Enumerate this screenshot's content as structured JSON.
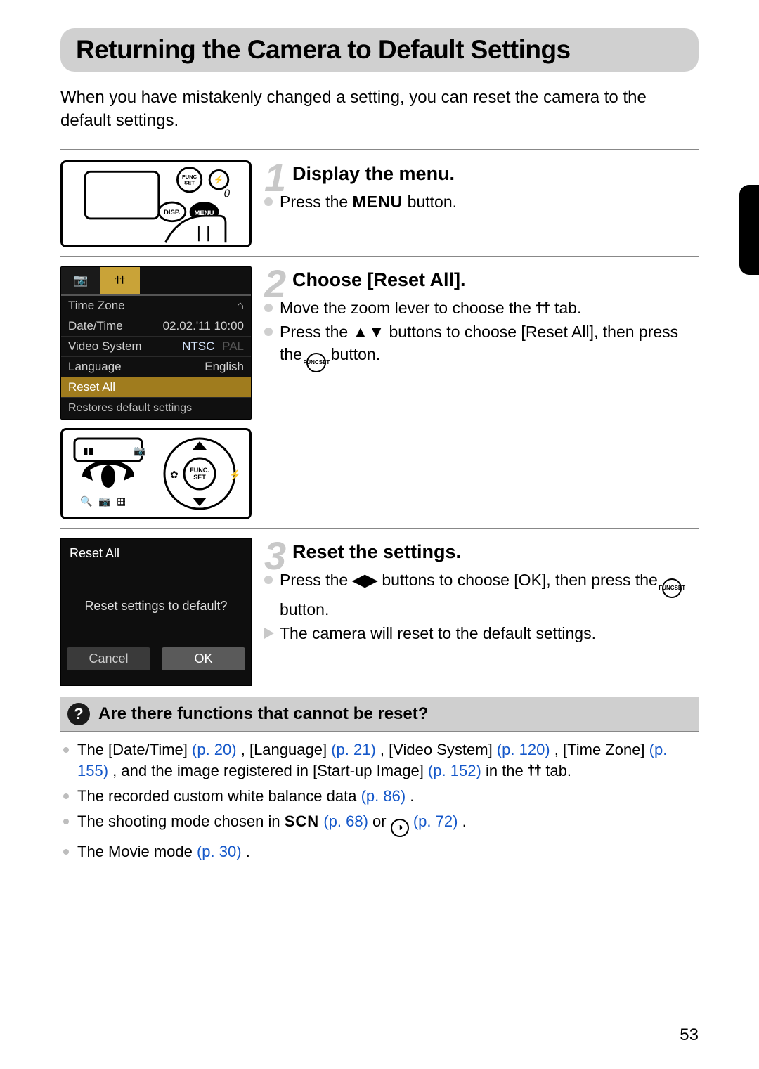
{
  "title": "Returning the Camera to Default Settings",
  "intro": "When you have mistakenly changed a setting, you can reset the camera to the default settings.",
  "steps": [
    {
      "num": "1",
      "heading": "Display the menu.",
      "line1a": "Press the ",
      "menu_word": "MENU",
      "line1b": " button."
    },
    {
      "num": "2",
      "heading": "Choose [Reset All].",
      "line1a": "Move the zoom lever to choose the ",
      "tool_glyph": "✦",
      "line1b": " tab.",
      "line2a": "Press the ",
      "ud_glyph": "▲▼",
      "line2b": " buttons to choose [Reset All], then press the ",
      "line2c": " button."
    },
    {
      "num": "3",
      "heading": "Reset the settings.",
      "line1a": "Press the ",
      "lr_glyph": "◀▶",
      "line1b": " buttons to choose [OK], then press the ",
      "line1c": " button.",
      "result": "The camera will reset to the default settings."
    }
  ],
  "menu_shot": {
    "items": [
      {
        "label": "Time Zone",
        "value": "⌂"
      },
      {
        "label": "Date/Time",
        "value": "02.02.'11 10:00"
      },
      {
        "label": "Video System",
        "value": "NTSC",
        "extra": "PAL"
      },
      {
        "label": "Language",
        "value": "English"
      },
      {
        "label": "Reset All",
        "value": ""
      }
    ],
    "footer": "Restores default settings"
  },
  "reset_shot": {
    "title": "Reset All",
    "msg": "Reset settings to default?",
    "cancel": "Cancel",
    "ok": "OK"
  },
  "funcset_top": "FUNC",
  "funcset_bot": "SET",
  "info": {
    "heading": "Are there functions that cannot be reset?",
    "i1a": "The [Date/Time] ",
    "p20": "(p. 20)",
    "i1b": ", [Language] ",
    "p21": "(p. 21)",
    "i1c": ", [Video System] ",
    "p120": "(p. 120)",
    "i1d": ", [Time Zone] ",
    "p155": "(p. 155)",
    "i1e": ", and the image registered in [Start-up Image] ",
    "p152": "(p. 152)",
    "i1f": " in the ",
    "i1g": " tab.",
    "i2a": "The recorded custom white balance data ",
    "p86": "(p. 86)",
    "i2b": ".",
    "i3a": "The shooting mode chosen in ",
    "scn": "SCN",
    "p68": "(p. 68)",
    "i3b": " or ",
    "p72": "(p. 72)",
    "i3c": ".",
    "i4a": "The Movie mode ",
    "p30": "(p. 30)",
    "i4b": "."
  },
  "page_number": "53"
}
